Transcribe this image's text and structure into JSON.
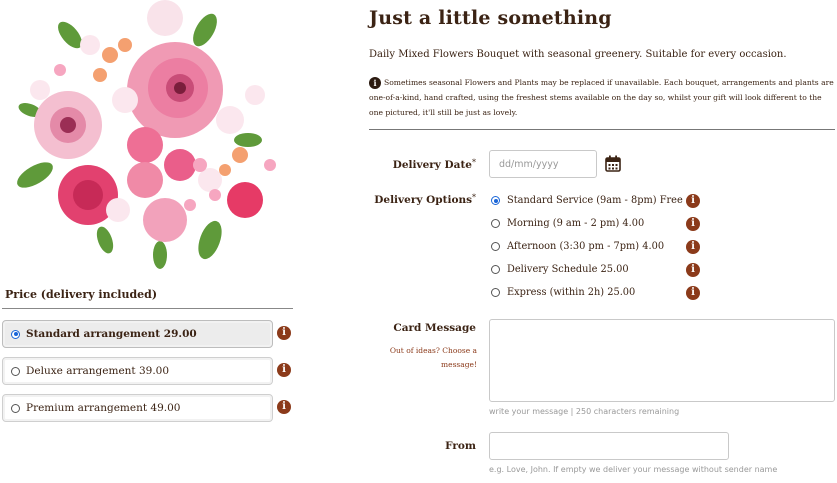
{
  "product": {
    "title": "Just a little something",
    "description": "Daily Mixed Flowers Bouquet with seasonal greenery. Suitable for every occasion.",
    "note": "Sometimes seasonal Flowers and Plants may be replaced if unavailable. Each bouquet, arrangements and plants are one-of-a-kind, hand crafted, using the freshest stems available on the day so, whilst your gift will look different to the one pictured, it'll still be just as lovely."
  },
  "price": {
    "heading": "Price (delivery included)",
    "options": [
      {
        "label": "Standard arrangement 29.00",
        "selected": true
      },
      {
        "label": "Deluxe arrangement 39.00",
        "selected": false
      },
      {
        "label": "Premium arrangement 49.00",
        "selected": false
      }
    ]
  },
  "delivery_date": {
    "label": "Delivery Date",
    "required_mark": "*",
    "placeholder": "dd/mm/yyyy"
  },
  "delivery_options": {
    "label": "Delivery Options",
    "required_mark": "*",
    "options": [
      {
        "label": "Standard Service (9am - 8pm) Free",
        "selected": true
      },
      {
        "label": "Morning (9 am - 2 pm) 4.00",
        "selected": false
      },
      {
        "label": "Afternoon (3:30 pm - 7pm) 4.00",
        "selected": false
      },
      {
        "label": "Delivery Schedule 25.00",
        "selected": false
      },
      {
        "label": "Express (within 2h) 25.00",
        "selected": false
      }
    ]
  },
  "card_message": {
    "label": "Card Message",
    "ideas_link": "Out of ideas? Choose a message!",
    "hint": "write your message | 250 characters remaining"
  },
  "from": {
    "label": "From",
    "hint": "e.g. Love, John. If empty we deliver your message without sender name"
  },
  "colors": {
    "accent_brown": "#8b3a1a",
    "text_brown": "#3b2314",
    "radio_blue": "#1a66d8"
  },
  "icons": [
    "info-icon",
    "calendar-icon"
  ]
}
